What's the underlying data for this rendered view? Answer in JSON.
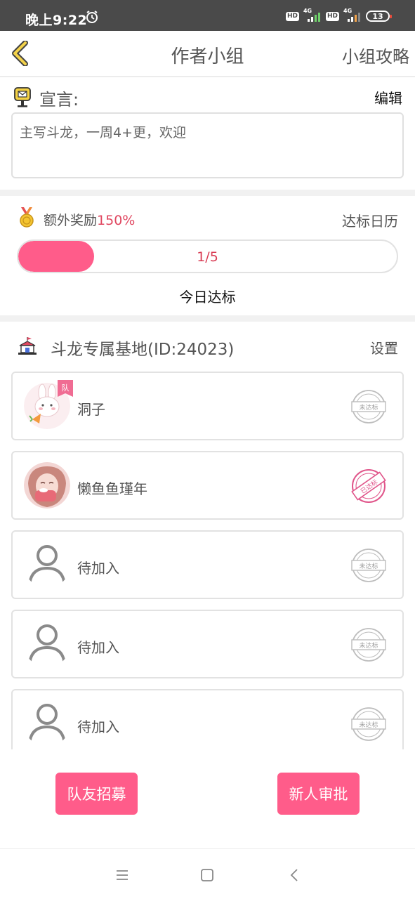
{
  "status_bar": {
    "time": "晚上9:22",
    "hd1": "HD",
    "net1": "4G",
    "hd2": "HD",
    "net2": "4G",
    "battery": "13"
  },
  "header": {
    "title": "作者小组",
    "guide": "小组攻略"
  },
  "declaration": {
    "label": "宣言:",
    "edit": "编辑",
    "text": "主写斗龙，一周4+更，欢迎"
  },
  "reward": {
    "prefix": "额外奖励",
    "percent": "150%",
    "calendar": "达标日历",
    "progress_label": "1/5",
    "progress_fraction": 0.2,
    "today": "今日达标"
  },
  "base": {
    "name": "斗龙专属基地(ID:24023)",
    "settings": "设置"
  },
  "members": [
    {
      "name": "洞子",
      "captain_badge": "队",
      "status": "未达标",
      "achieved": false
    },
    {
      "name": "懒鱼鱼瑾年",
      "status": "已达标",
      "achieved": true
    },
    {
      "name": "待加入",
      "status": "未达标",
      "achieved": false
    },
    {
      "name": "待加入",
      "status": "未达标",
      "achieved": false
    },
    {
      "name": "待加入",
      "status": "未达标",
      "achieved": false
    }
  ],
  "actions": {
    "recruit": "队友招募",
    "review": "新人审批"
  },
  "colors": {
    "accent": "#ff5c8a",
    "percent_text": "#e04760",
    "status_bar": "#4a4a4a",
    "achieved_stamp": "#e0558a"
  },
  "icons": {
    "back": "chevron-left-icon",
    "alarm": "alarm-icon",
    "mailbox": "mailbox-icon",
    "medal": "medal-icon",
    "base": "castle-icon",
    "stamp": "stamp-icon",
    "placeholder_avatar": "person-icon"
  }
}
